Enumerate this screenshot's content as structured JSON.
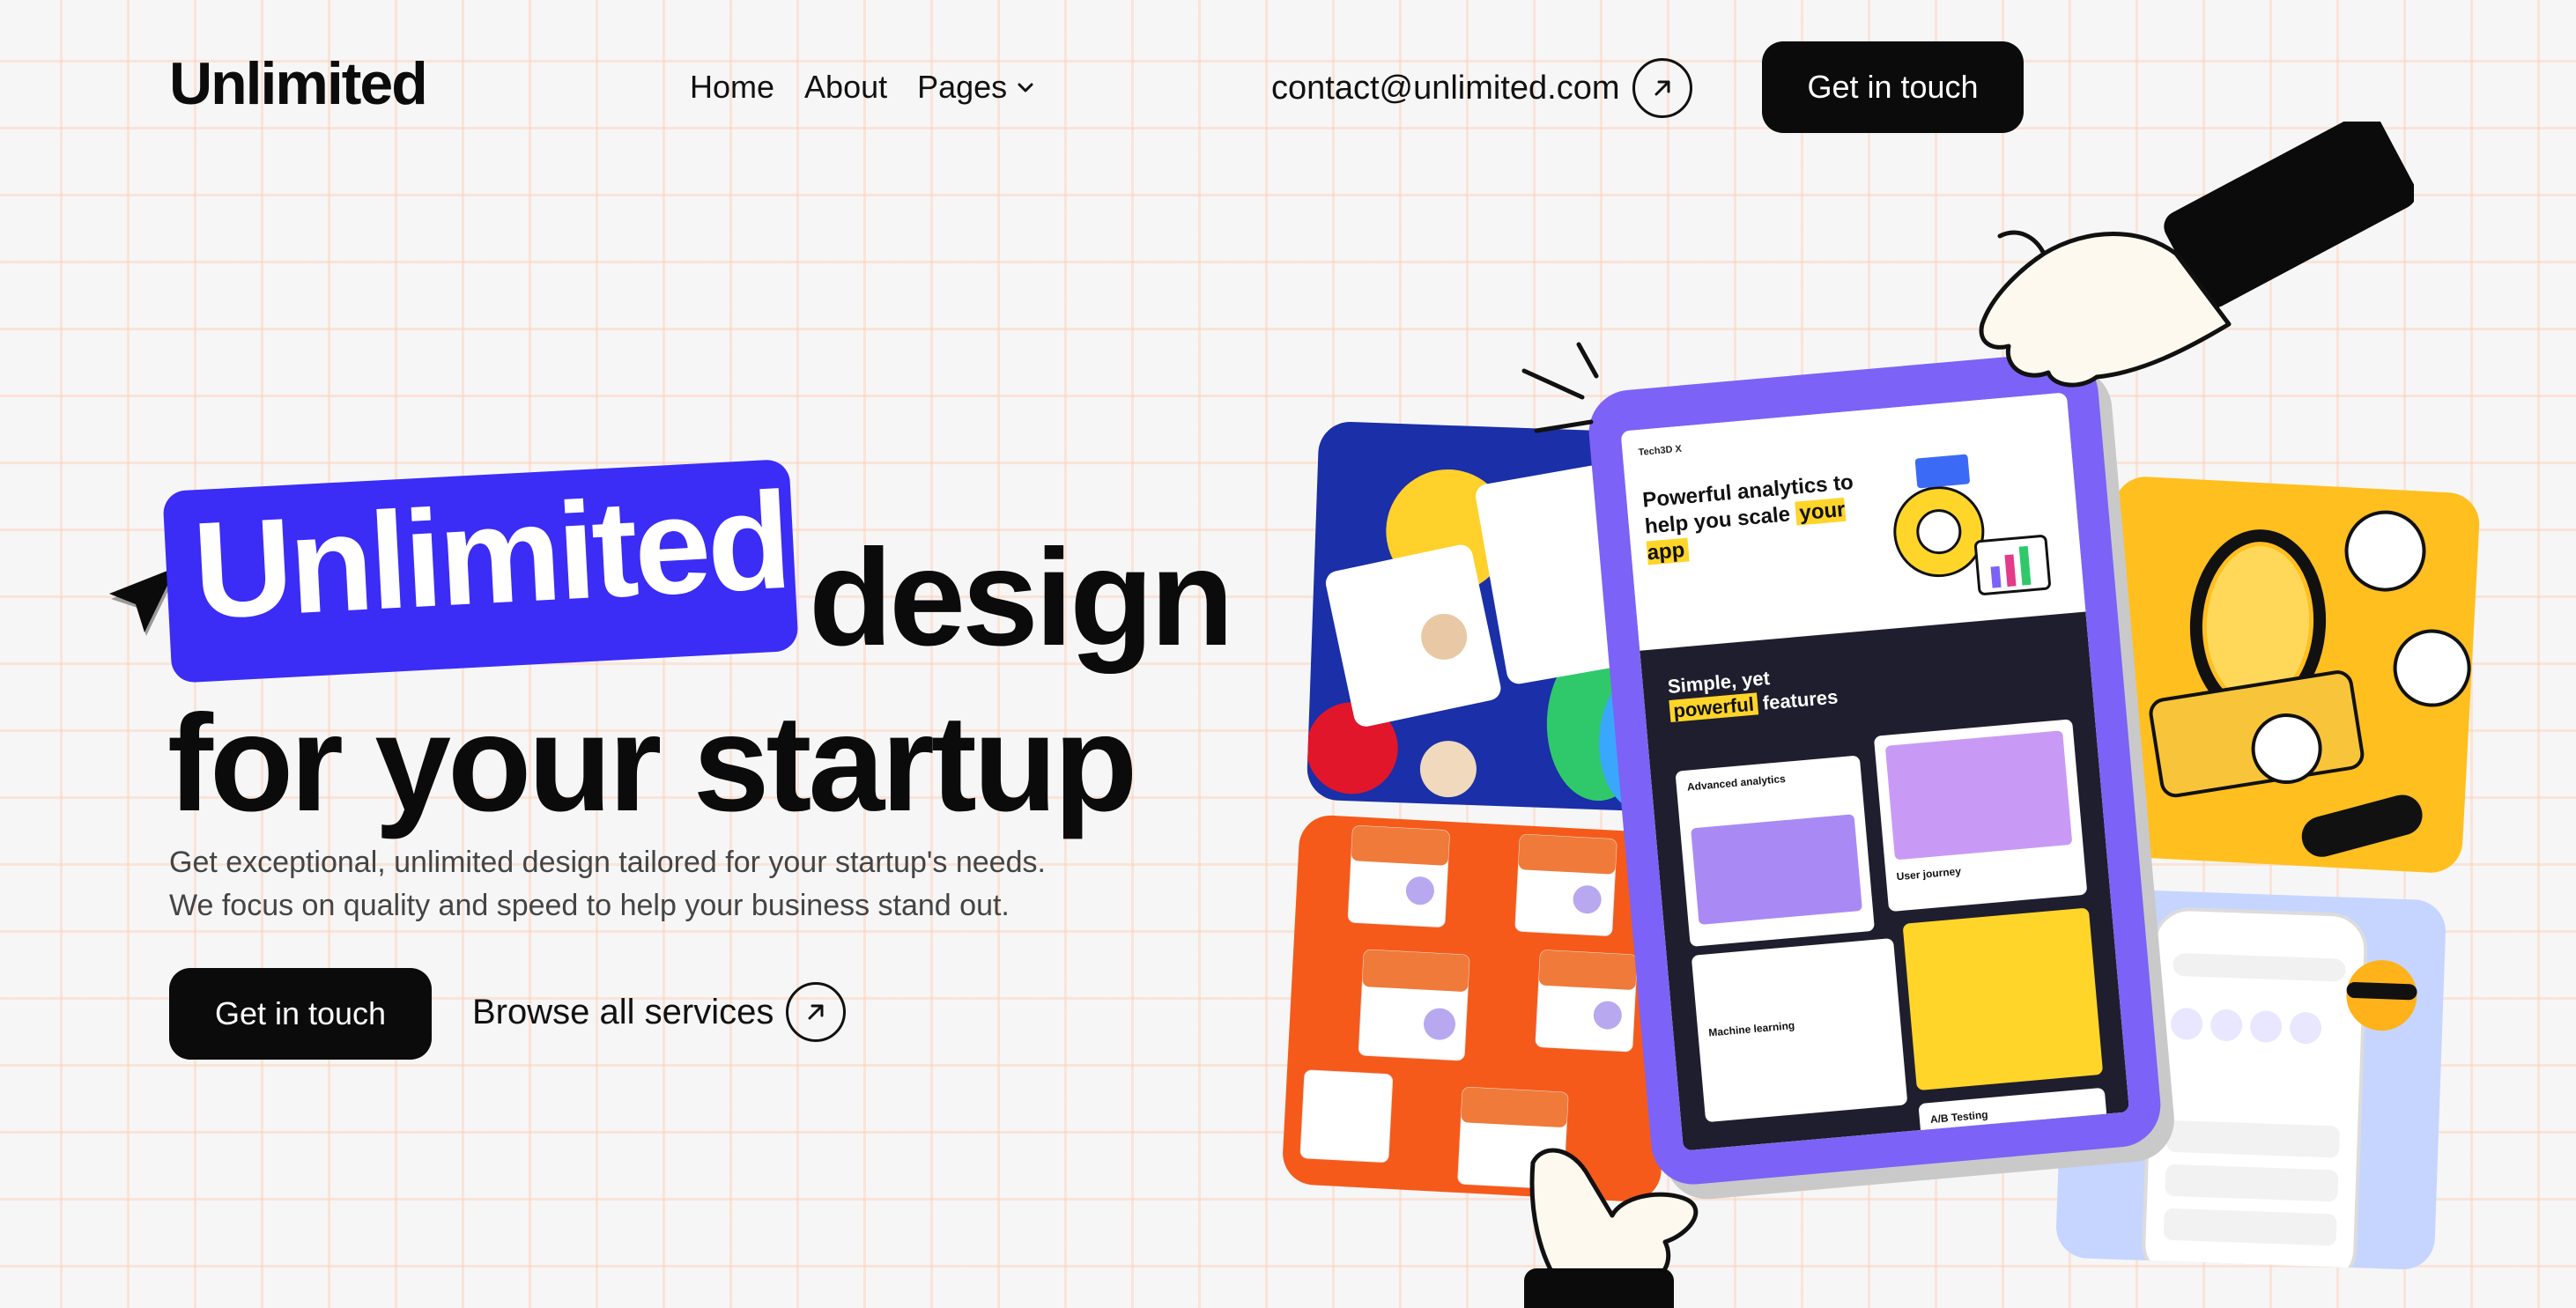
{
  "header": {
    "logo": "Unlimited",
    "nav": {
      "home": "Home",
      "about": "About",
      "pages": "Pages"
    },
    "email": "contact@unlimited.com",
    "cta": "Get in touch"
  },
  "hero": {
    "highlight": "Unlimited",
    "headline_rest": "design",
    "headline_line2": "for your startup",
    "subtitle_line1": "Get exceptional, unlimited design tailored for your startup's needs.",
    "subtitle_line2": "We focus on quality and speed to help your business stand out.",
    "primary_cta": "Get in touch",
    "secondary_cta": "Browse all services"
  },
  "mockup": {
    "brand": "Tech3D X",
    "headline_a": "Powerful analytics to help you scale",
    "headline_b": "your app",
    "section_a": "Simple, yet",
    "section_b": "powerful",
    "section_c": "features",
    "tiles": [
      "Advanced analytics",
      "User journey",
      "Machine learning",
      "A/B Testing"
    ]
  },
  "colors": {
    "accent": "#3b2cf6",
    "dark": "#0b0b0b",
    "tablet": "#7c62f6",
    "highlight_yellow": "#ffd52a"
  },
  "icons": [
    "arrow-up-right-icon",
    "chevron-down-icon",
    "cursor-arrow-icon"
  ]
}
